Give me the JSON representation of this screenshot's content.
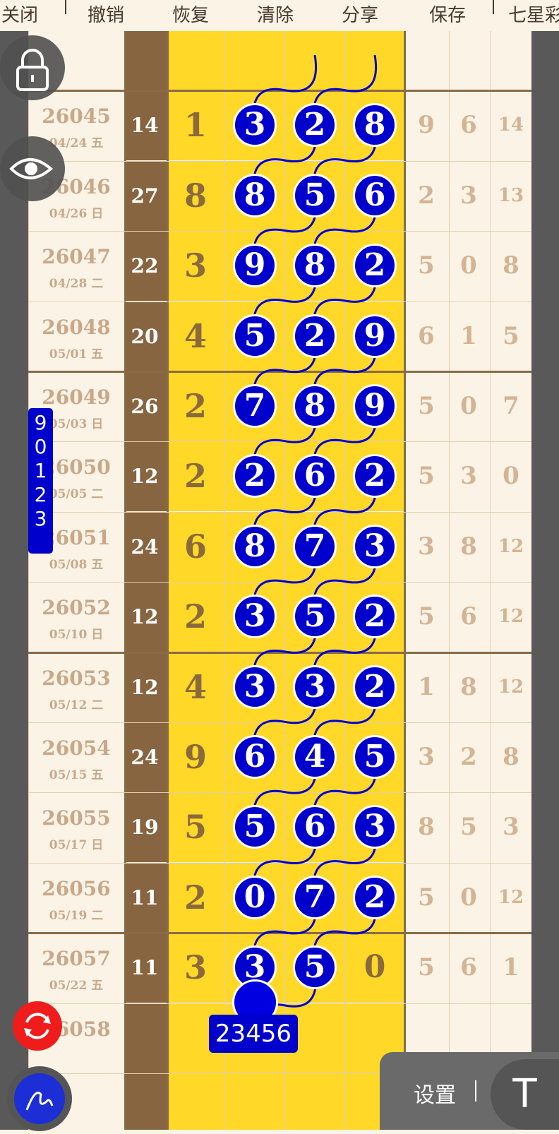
{
  "toolbar": {
    "items": [
      "关闭",
      "撤销",
      "恢复",
      "清除",
      "分享",
      "保存",
      "七星彩"
    ]
  },
  "side_label": {
    "digits": [
      "9",
      "0",
      "1",
      "2",
      "3"
    ]
  },
  "prediction": {
    "label": "23456"
  },
  "settings": {
    "label": "设置",
    "t_button": "T"
  },
  "rows": [
    {
      "issue": "26045",
      "date": "04/24 五",
      "sum": "14",
      "d": "1",
      "balls": [
        "3",
        "2",
        "8"
      ],
      "rest": [
        "9",
        "6",
        "14"
      ]
    },
    {
      "issue": "26046",
      "date": "04/26 日",
      "sum": "27",
      "d": "8",
      "balls": [
        "8",
        "5",
        "6"
      ],
      "rest": [
        "2",
        "3",
        "13"
      ]
    },
    {
      "issue": "26047",
      "date": "04/28 二",
      "sum": "22",
      "d": "3",
      "balls": [
        "9",
        "8",
        "2"
      ],
      "rest": [
        "5",
        "0",
        "8"
      ]
    },
    {
      "issue": "26048",
      "date": "05/01 五",
      "sum": "20",
      "d": "4",
      "balls": [
        "5",
        "2",
        "9"
      ],
      "rest": [
        "6",
        "1",
        "5"
      ]
    },
    {
      "issue": "26049",
      "date": "05/03 日",
      "sum": "26",
      "d": "2",
      "balls": [
        "7",
        "8",
        "9"
      ],
      "rest": [
        "5",
        "0",
        "7"
      ]
    },
    {
      "issue": "26050",
      "date": "05/05 二",
      "sum": "12",
      "d": "2",
      "balls": [
        "2",
        "6",
        "2"
      ],
      "rest": [
        "5",
        "3",
        "0"
      ]
    },
    {
      "issue": "26051",
      "date": "05/08 五",
      "sum": "24",
      "d": "6",
      "balls": [
        "8",
        "7",
        "3"
      ],
      "rest": [
        "3",
        "8",
        "12"
      ]
    },
    {
      "issue": "26052",
      "date": "05/10 日",
      "sum": "12",
      "d": "2",
      "balls": [
        "3",
        "5",
        "2"
      ],
      "rest": [
        "5",
        "6",
        "12"
      ]
    },
    {
      "issue": "26053",
      "date": "05/12 二",
      "sum": "12",
      "d": "4",
      "balls": [
        "3",
        "3",
        "2"
      ],
      "rest": [
        "1",
        "8",
        "12"
      ]
    },
    {
      "issue": "26054",
      "date": "05/15 五",
      "sum": "24",
      "d": "9",
      "balls": [
        "6",
        "4",
        "5"
      ],
      "rest": [
        "3",
        "2",
        "8"
      ]
    },
    {
      "issue": "26055",
      "date": "05/17 日",
      "sum": "19",
      "d": "5",
      "balls": [
        "5",
        "6",
        "3"
      ],
      "rest": [
        "8",
        "5",
        "3"
      ]
    },
    {
      "issue": "26056",
      "date": "05/19 二",
      "sum": "11",
      "d": "2",
      "balls": [
        "0",
        "7",
        "2"
      ],
      "rest": [
        "5",
        "0",
        "12"
      ]
    },
    {
      "issue": "26057",
      "date": "05/22 五",
      "sum": "11",
      "d": "3",
      "balls": [
        "3",
        "5"
      ],
      "plain": "0",
      "rest": [
        "5",
        "6",
        "1"
      ]
    },
    {
      "issue": "26058",
      "date": "",
      "sum": "",
      "d": "",
      "balls": [],
      "rest": [
        "",
        "",
        ""
      ]
    }
  ]
}
